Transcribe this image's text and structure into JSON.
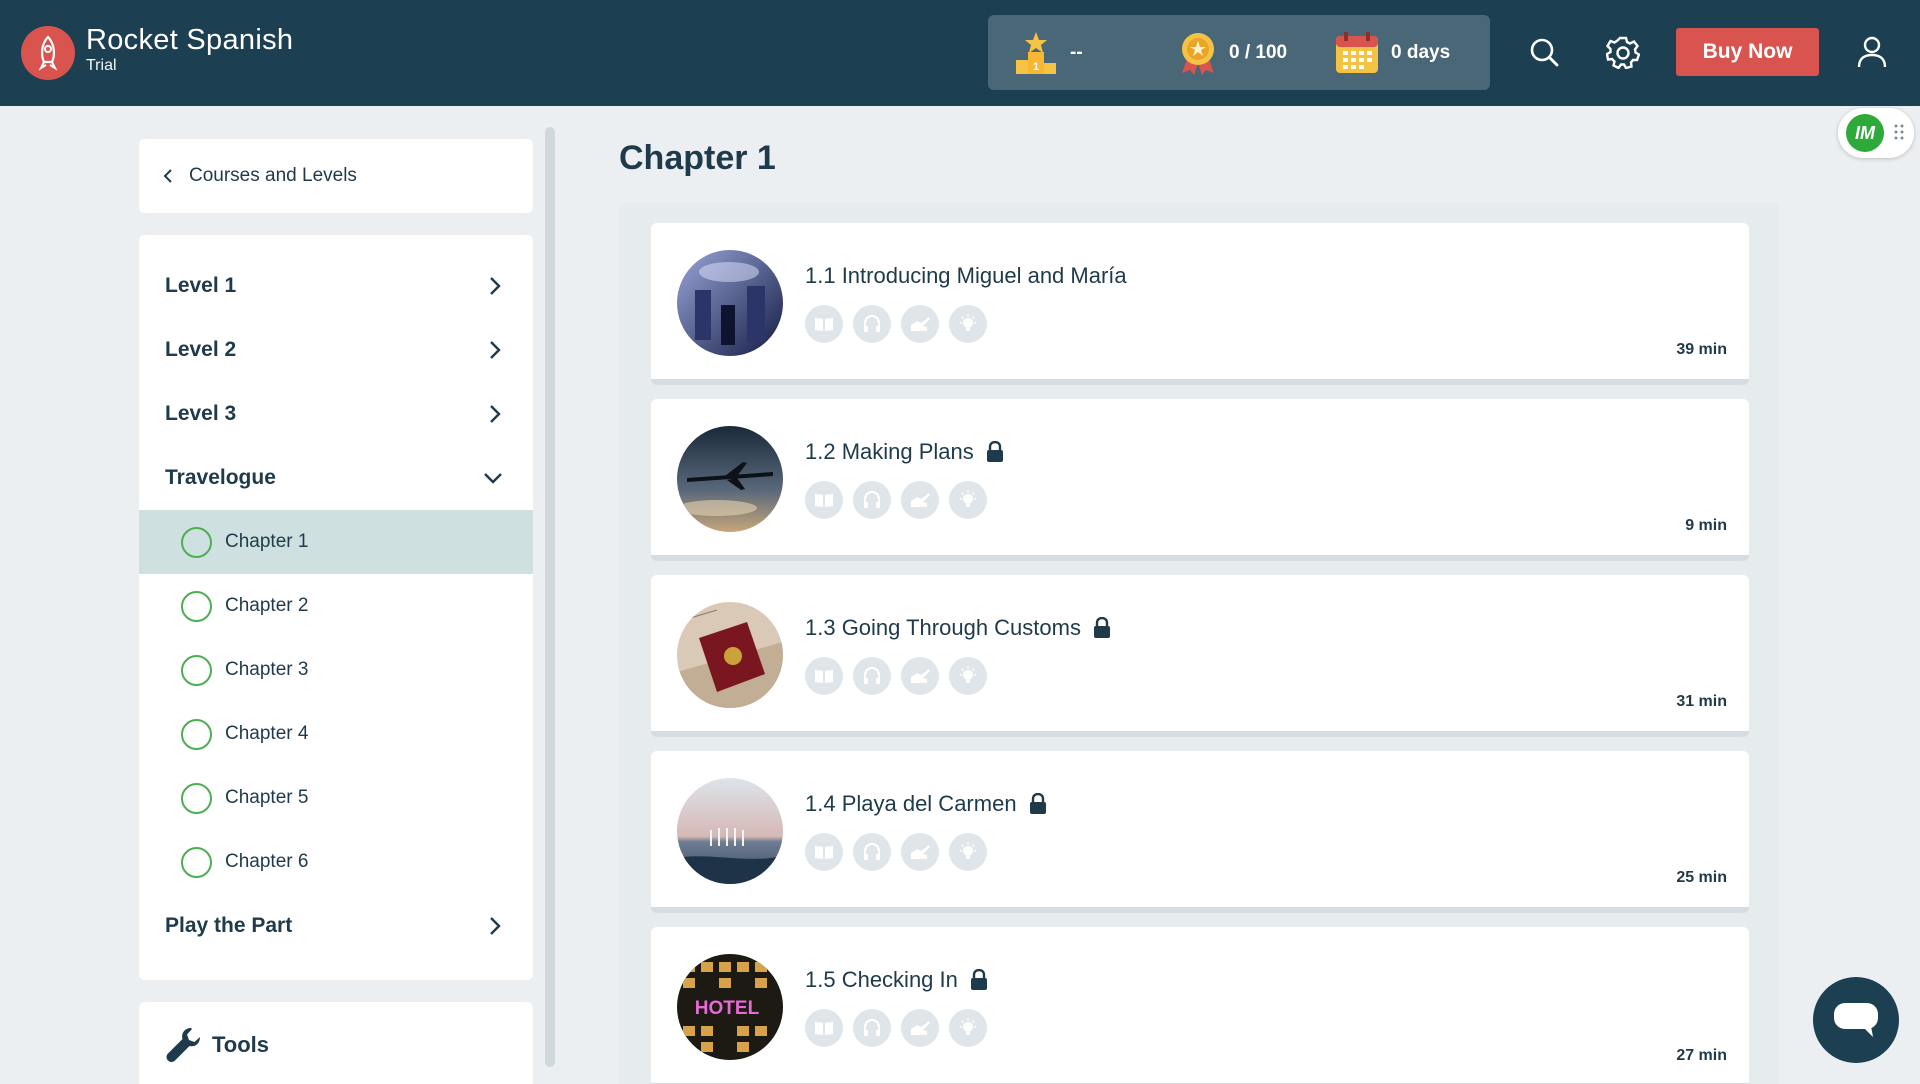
{
  "header": {
    "brand_name": "Rocket Spanish",
    "brand_sub": "Trial",
    "stats": {
      "rank_value": "--",
      "points_value": "0 / 100",
      "streak_value": "0 days"
    },
    "buy_label": "Buy Now"
  },
  "sidebar": {
    "back_label": "Courses and Levels",
    "levels": [
      {
        "label": "Level 1"
      },
      {
        "label": "Level 2"
      },
      {
        "label": "Level 3"
      },
      {
        "label": "Travelogue"
      }
    ],
    "chapters": [
      {
        "label": "Chapter 1"
      },
      {
        "label": "Chapter 2"
      },
      {
        "label": "Chapter 3"
      },
      {
        "label": "Chapter 4"
      },
      {
        "label": "Chapter 5"
      },
      {
        "label": "Chapter 6"
      }
    ],
    "play_part_label": "Play the Part",
    "tools_label": "Tools"
  },
  "main": {
    "title": "Chapter 1",
    "lessons": [
      {
        "title": "1.1 Introducing Miguel and María",
        "duration": "39 min"
      },
      {
        "title": "1.2 Making Plans",
        "duration": "9 min"
      },
      {
        "title": "1.3 Going Through Customs",
        "duration": "31 min"
      },
      {
        "title": "1.4 Playa del Carmen",
        "duration": "25 min"
      },
      {
        "title": "1.5 Checking In",
        "duration": "27 min",
        "thumb_text": "HOTEL"
      }
    ]
  },
  "extension": {
    "logo_text": "IM"
  },
  "colors": {
    "header_bg": "#1c3f52",
    "accent": "#d9534f",
    "progress_green": "#4caf50",
    "active_item": "#cfe0e0"
  }
}
